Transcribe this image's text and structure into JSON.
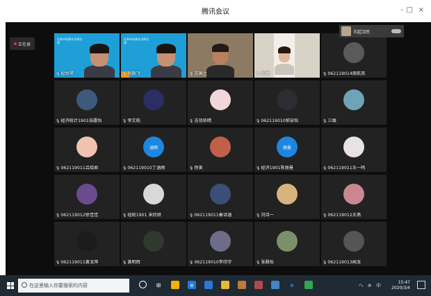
{
  "window": {
    "title": "腾讯会议",
    "controls": {
      "minimize": "-",
      "maximize": "□",
      "close": "×"
    }
  },
  "sidebar": {
    "badge_label": "正在录"
  },
  "host_overlay": {
    "name": "王起汉民"
  },
  "tiles": [
    {
      "name": "段世琴",
      "kind": "video-slide",
      "slide_text": "证券市场基本法律法规"
    },
    {
      "name": "杨斯飞",
      "kind": "video-slide",
      "slide_text": "证券市场基本法律法规",
      "speaking": true
    },
    {
      "name": "吉国之",
      "kind": "video-room"
    },
    {
      "name": "钱婷",
      "kind": "video-light"
    },
    {
      "name": "062119014周航英",
      "kind": "avatar",
      "color": "#5a5a5a"
    },
    {
      "name": "经济统计1901张露怡",
      "kind": "avatar",
      "color": "#3e5a7a"
    },
    {
      "name": "李文皓",
      "kind": "avatar",
      "color": "#2b2d63"
    },
    {
      "name": "吉羽依晴",
      "kind": "avatar",
      "color": "#f2d7da"
    },
    {
      "name": "062119010郝宏怡",
      "kind": "avatar",
      "color": "#2c2c34"
    },
    {
      "name": "三頭",
      "kind": "avatar",
      "color": "#6fa3b8"
    },
    {
      "name": "062119011吕晓君",
      "kind": "avatar",
      "color": "#f0c3b0"
    },
    {
      "name": "062119010丁涵雨",
      "kind": "avatar",
      "color": "#1e86e0",
      "text": "涵雨"
    },
    {
      "name": "徐美",
      "kind": "avatar",
      "color": "#c0604a"
    },
    {
      "name": "经济1901陈丽曼",
      "kind": "avatar",
      "color": "#1e86e0",
      "text": "丽曼"
    },
    {
      "name": "062119011王一鸣",
      "kind": "avatar",
      "color": "#e8e2e2"
    },
    {
      "name": "062119012徐佳佳",
      "kind": "avatar",
      "color": "#6a4b8e"
    },
    {
      "name": "经统1901 宋欣妍",
      "kind": "avatar",
      "color": "#d8d8d8"
    },
    {
      "name": "062119011秦诗涵",
      "kind": "avatar",
      "color": "#3a4f77"
    },
    {
      "name": "刘诗一",
      "kind": "avatar",
      "color": "#d7b47c"
    },
    {
      "name": "062119012王燕",
      "kind": "avatar",
      "color": "#c98790"
    },
    {
      "name": "062119011黄玉萍",
      "kind": "avatar",
      "color": "#1c1c1c"
    },
    {
      "name": "黄明辉",
      "kind": "avatar",
      "color": "#2e3a2e"
    },
    {
      "name": "062119010李欣宇",
      "kind": "avatar",
      "color": "#6d6d8a"
    },
    {
      "name": "张雅怡",
      "kind": "avatar",
      "color": "#7b8f6a"
    },
    {
      "name": "062119013闻龙",
      "kind": "avatar",
      "color": "#555555"
    }
  ],
  "taskbar": {
    "search_placeholder": "在这里输入你要搜索的内容",
    "time": "15:47",
    "date": "2020/3/4",
    "tray_text": "へ ⊕ 中"
  },
  "colors": {
    "meeting_bg": "#0d0d0d",
    "tile_bg": "#222222",
    "speaking": "#f39a1a",
    "taskbar": "#1f2a33"
  }
}
